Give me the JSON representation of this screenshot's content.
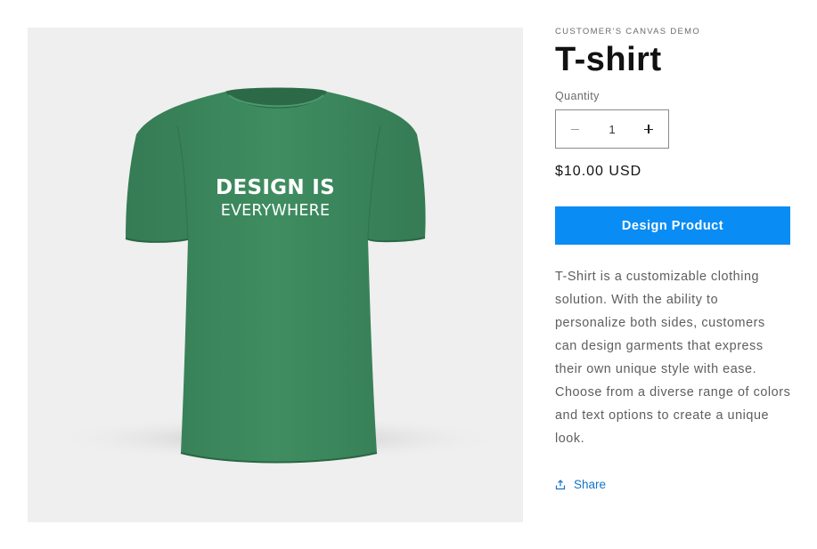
{
  "product": {
    "vendor": "CUSTOMER'S CANVAS DEMO",
    "title": "T-shirt",
    "price": "$10.00 USD",
    "description": "T-Shirt is a customizable clothing solution. With the ability to personalize both sides, customers can design garments that express their own unique style with ease. Choose from a diverse range of colors and text options to create a unique look."
  },
  "image": {
    "text_line1": "DESIGN IS",
    "text_line2": "EVERYWHERE",
    "shirt_color": "#3d8a5f",
    "background": "#efefef"
  },
  "quantity": {
    "label": "Quantity",
    "value": "1"
  },
  "actions": {
    "design_label": "Design Product",
    "share_label": "Share"
  },
  "colors": {
    "accent": "#0a8cf5",
    "link": "#1473c8"
  },
  "icons": {
    "minus": "minus-icon",
    "plus": "plus-icon",
    "share": "share-icon"
  }
}
